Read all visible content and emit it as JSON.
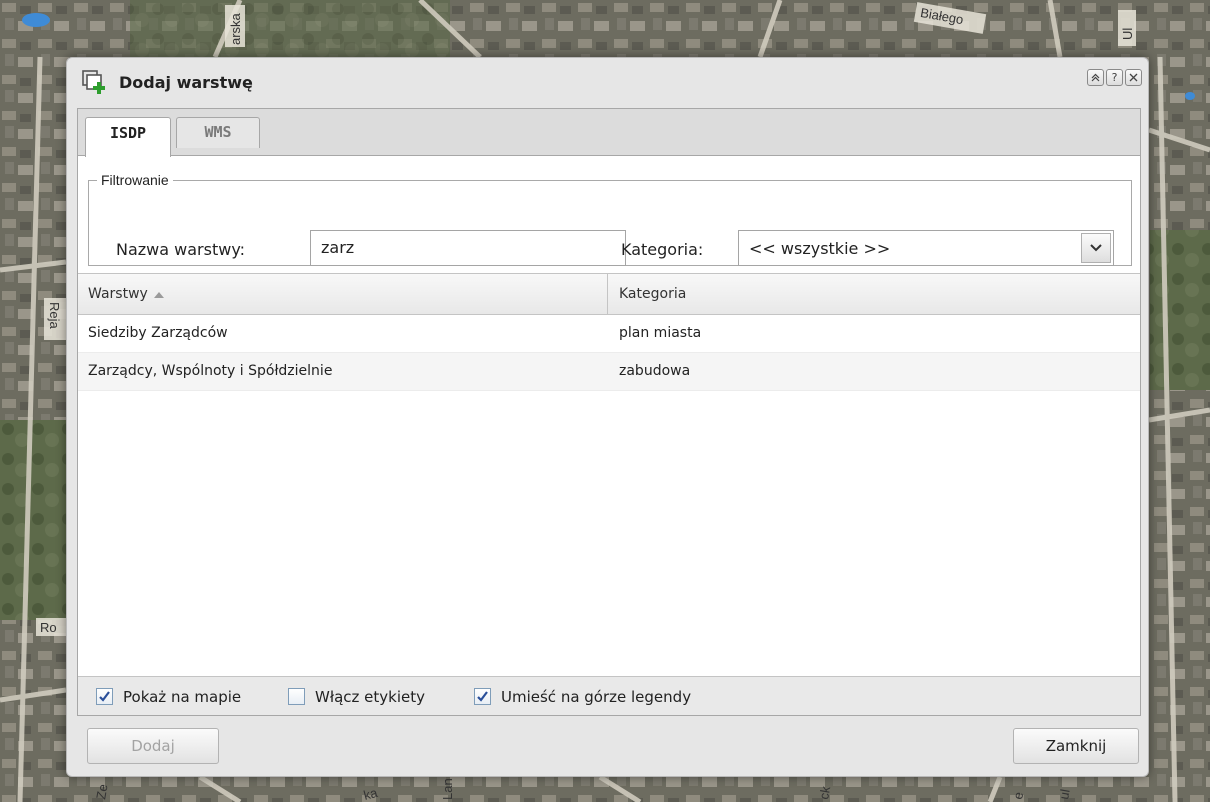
{
  "dialog": {
    "title": "Dodaj warstwę",
    "tool_icons": [
      "collapse-icon",
      "help-icon",
      "close-icon"
    ],
    "tool_help": "?"
  },
  "tabs": [
    {
      "label": "ISDP",
      "active": true
    },
    {
      "label": "WMS",
      "active": false
    }
  ],
  "filter": {
    "legend": "Filtrowanie",
    "name_label": "Nazwa warstwy:",
    "name_value": "zarz",
    "category_label": "Kategoria:",
    "category_value": "<< wszystkie >>"
  },
  "grid": {
    "columns": [
      "Warstwy",
      "Kategoria"
    ],
    "rows": [
      {
        "name": "Siedziby Zarządców",
        "category": "plan miasta"
      },
      {
        "name": "Zarządcy, Wspólnoty i Spółdzielnie",
        "category": "zabudowa"
      }
    ]
  },
  "options": [
    {
      "label": "Pokaż na mapie",
      "checked": true
    },
    {
      "label": "Włącz etykiety",
      "checked": false
    },
    {
      "label": "Umieść na górze legendy",
      "checked": true
    }
  ],
  "buttons": {
    "add": "Dodaj",
    "close": "Zamknij"
  },
  "map_labels": {
    "top_street_1": "arska",
    "top_street_2": "Białego",
    "top_street_3": "Ul",
    "left_street_1": "Reja",
    "left_street_2": "Ro",
    "bottom_street_1": "Ze",
    "bottom_street_2": "ka",
    "bottom_street_3": "Lan",
    "bottom_street_4": "ck",
    "bottom_street_5": "e",
    "bottom_street_6": "ul"
  },
  "colors": {
    "checkbox_mark": "#2a4f9a",
    "add_icon_green": "#2e9e2e"
  }
}
